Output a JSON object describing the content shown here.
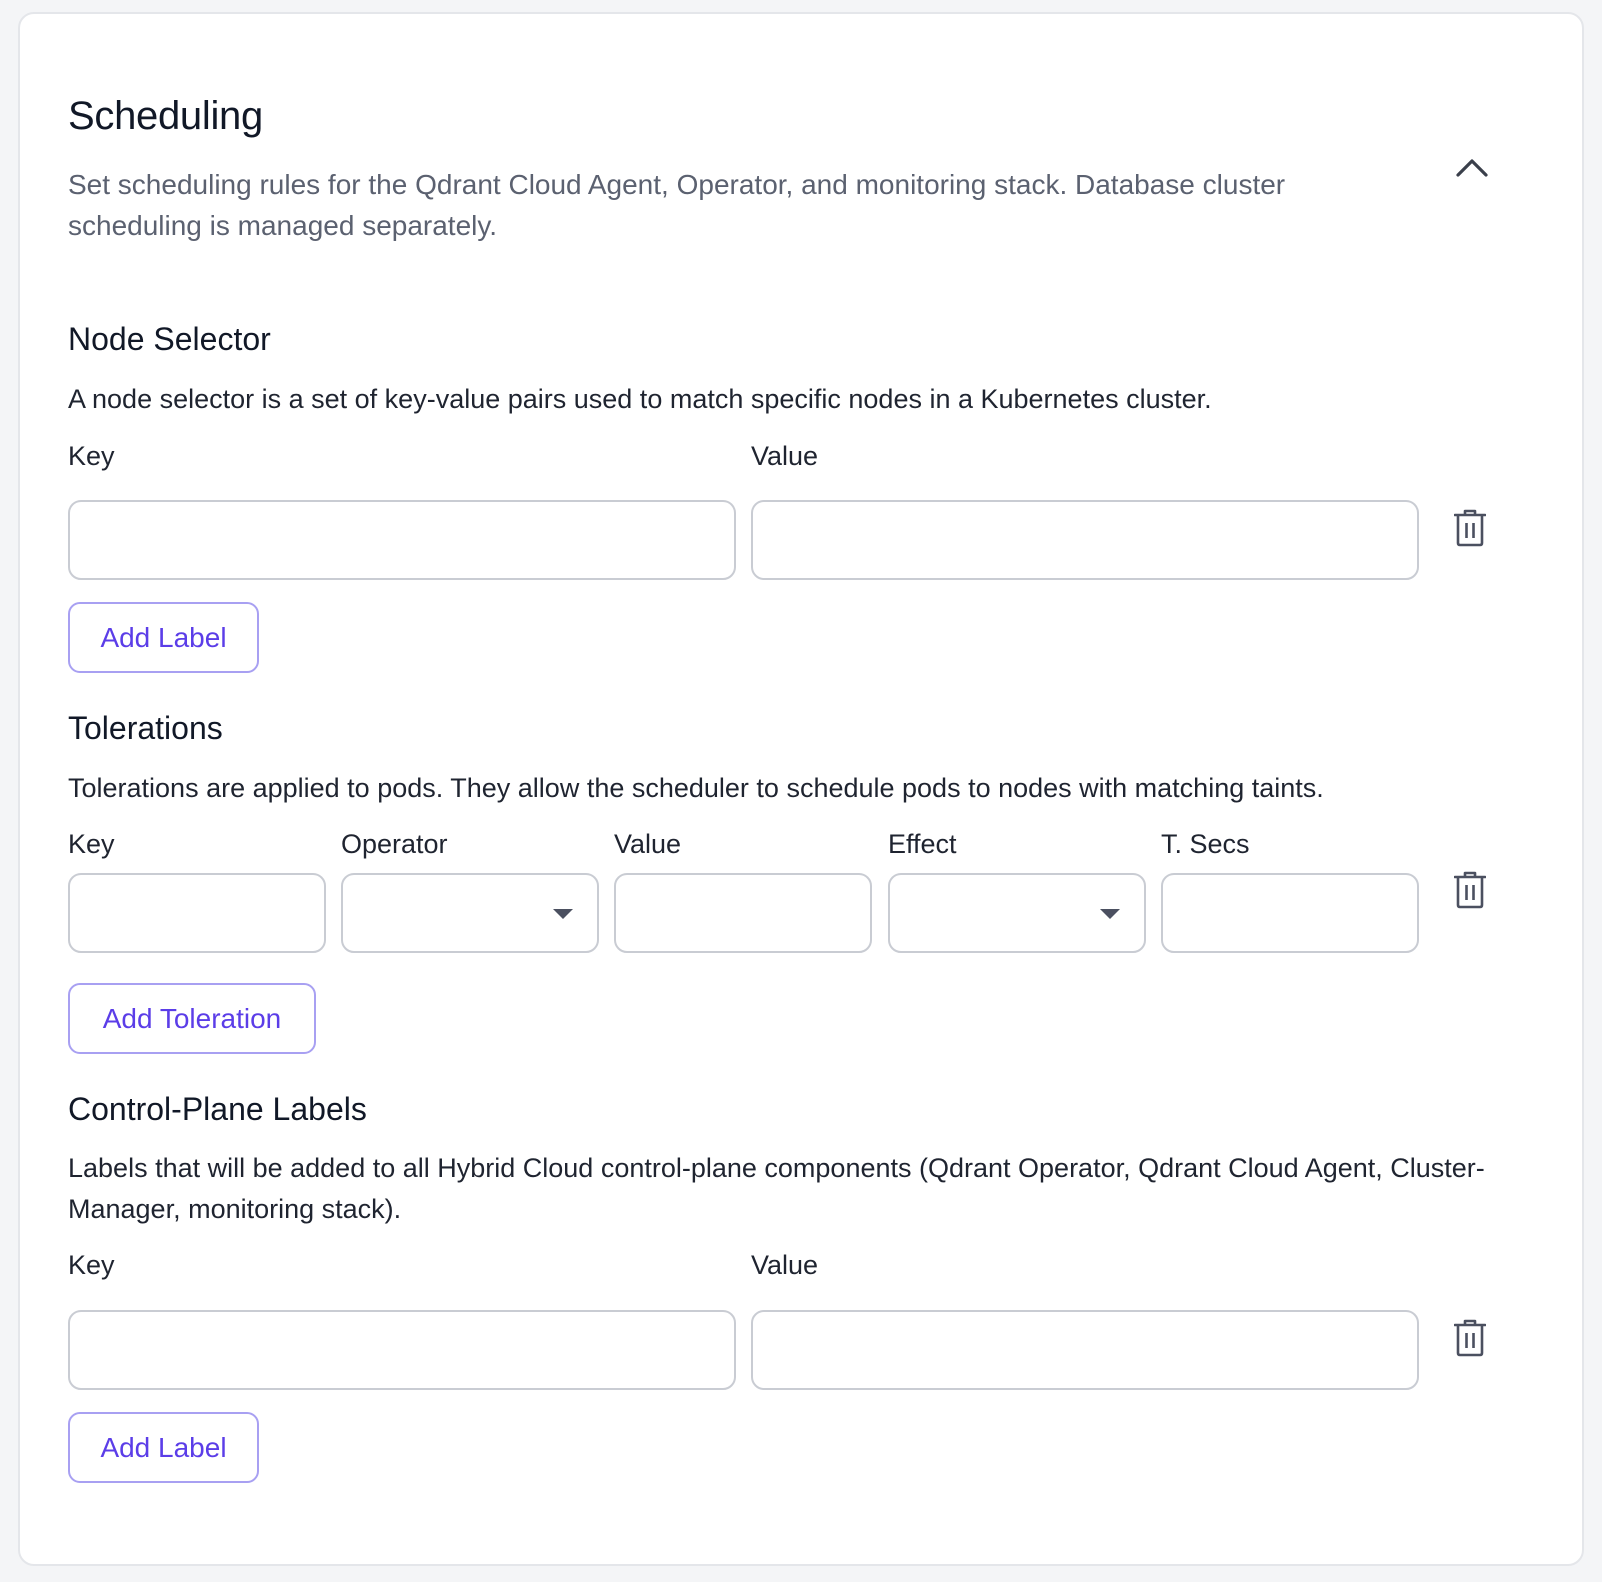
{
  "header": {
    "title": "Scheduling",
    "subtitle": "Set scheduling rules for the Qdrant Cloud Agent, Operator, and monitoring stack. Database cluster scheduling is managed separately.",
    "collapse_icon": "chevron-up-icon"
  },
  "node_selector": {
    "title": "Node Selector",
    "description": "A node selector is a set of key-value pairs used to match specific nodes in a Kubernetes cluster.",
    "key_label": "Key",
    "value_label": "Value",
    "key_value": "",
    "value_value": "",
    "delete_icon": "trash-icon",
    "add_button": "Add Label"
  },
  "tolerations": {
    "title": "Tolerations",
    "description": "Tolerations are applied to pods. They allow the scheduler to schedule pods to nodes with matching taints.",
    "key_label": "Key",
    "operator_label": "Operator",
    "value_label": "Value",
    "effect_label": "Effect",
    "secs_label": "T. Secs",
    "operator_selected": "",
    "effect_selected": "",
    "delete_icon": "trash-icon",
    "add_button": "Add Toleration"
  },
  "control_plane_labels": {
    "title": "Control-Plane Labels",
    "description": "Labels that will be added to all Hybrid Cloud control-plane components (Qdrant Operator, Qdrant Cloud Agent, Cluster-Manager, monitoring stack).",
    "key_label": "Key",
    "value_label": "Value",
    "key_value": "",
    "value_value": "",
    "delete_icon": "trash-icon",
    "add_button": "Add Label"
  },
  "colors": {
    "accent": "#5b3de8",
    "button_border": "#a8a0f2",
    "input_border": "#c9ccd3",
    "muted_text": "#5b6170"
  }
}
